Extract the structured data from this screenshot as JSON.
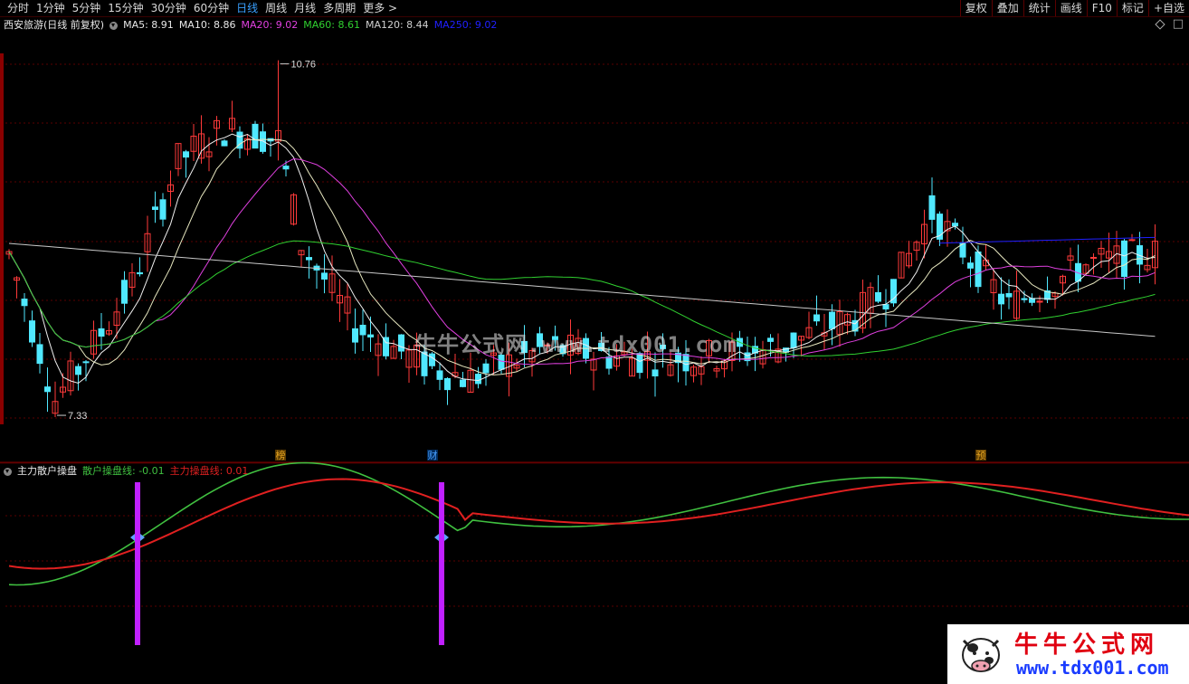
{
  "toolbar": {
    "tabs": [
      "分时",
      "1分钟",
      "5分钟",
      "15分钟",
      "30分钟",
      "60分钟",
      "日线",
      "周线",
      "月线",
      "多周期",
      "更多 >"
    ],
    "active_tab": "日线",
    "right_tools": [
      "复权",
      "叠加",
      "统计",
      "画线",
      "F10",
      "标记",
      "+自选"
    ]
  },
  "main_chart": {
    "stock_name": "西安旅游(日线 前复权)",
    "ma": [
      {
        "label": "MA5: 8.91",
        "color": "#e8e8e8"
      },
      {
        "label": "MA10: 8.86",
        "color": "#e8e8e8"
      },
      {
        "label": "MA20: 9.02",
        "color": "#e040e0"
      },
      {
        "label": "MA60: 8.61",
        "color": "#30d030"
      },
      {
        "label": "MA120: 8.44",
        "color": "#d0d0d0"
      },
      {
        "label": "MA250: 9.02",
        "color": "#2020ff"
      }
    ],
    "high_label": "10.76",
    "low_label": "7.33",
    "event_markers": [
      {
        "text": "榜",
        "color": "#e0a020",
        "bg": "#5a3a00"
      },
      {
        "text": "财",
        "color": "#4aa0ff",
        "bg": "#002a5a"
      },
      {
        "text": "预",
        "color": "#e0a020",
        "bg": "#5a3a00"
      }
    ]
  },
  "indicator": {
    "name": "主力散户操盘",
    "lines": [
      {
        "label": "散户操盘线: -0.01",
        "color": "#40c040"
      },
      {
        "label": "主力操盘线: 0.01",
        "color": "#e02020"
      }
    ]
  },
  "watermark": "牛牛公式网.www.tdx001.com",
  "logo": {
    "title": "牛牛公式网",
    "url": "www.tdx001.com"
  },
  "colors": {
    "up": "#ff3a3a",
    "down": "#50e8ff",
    "grid": "#5a0000",
    "signal": "#c020ff"
  }
}
